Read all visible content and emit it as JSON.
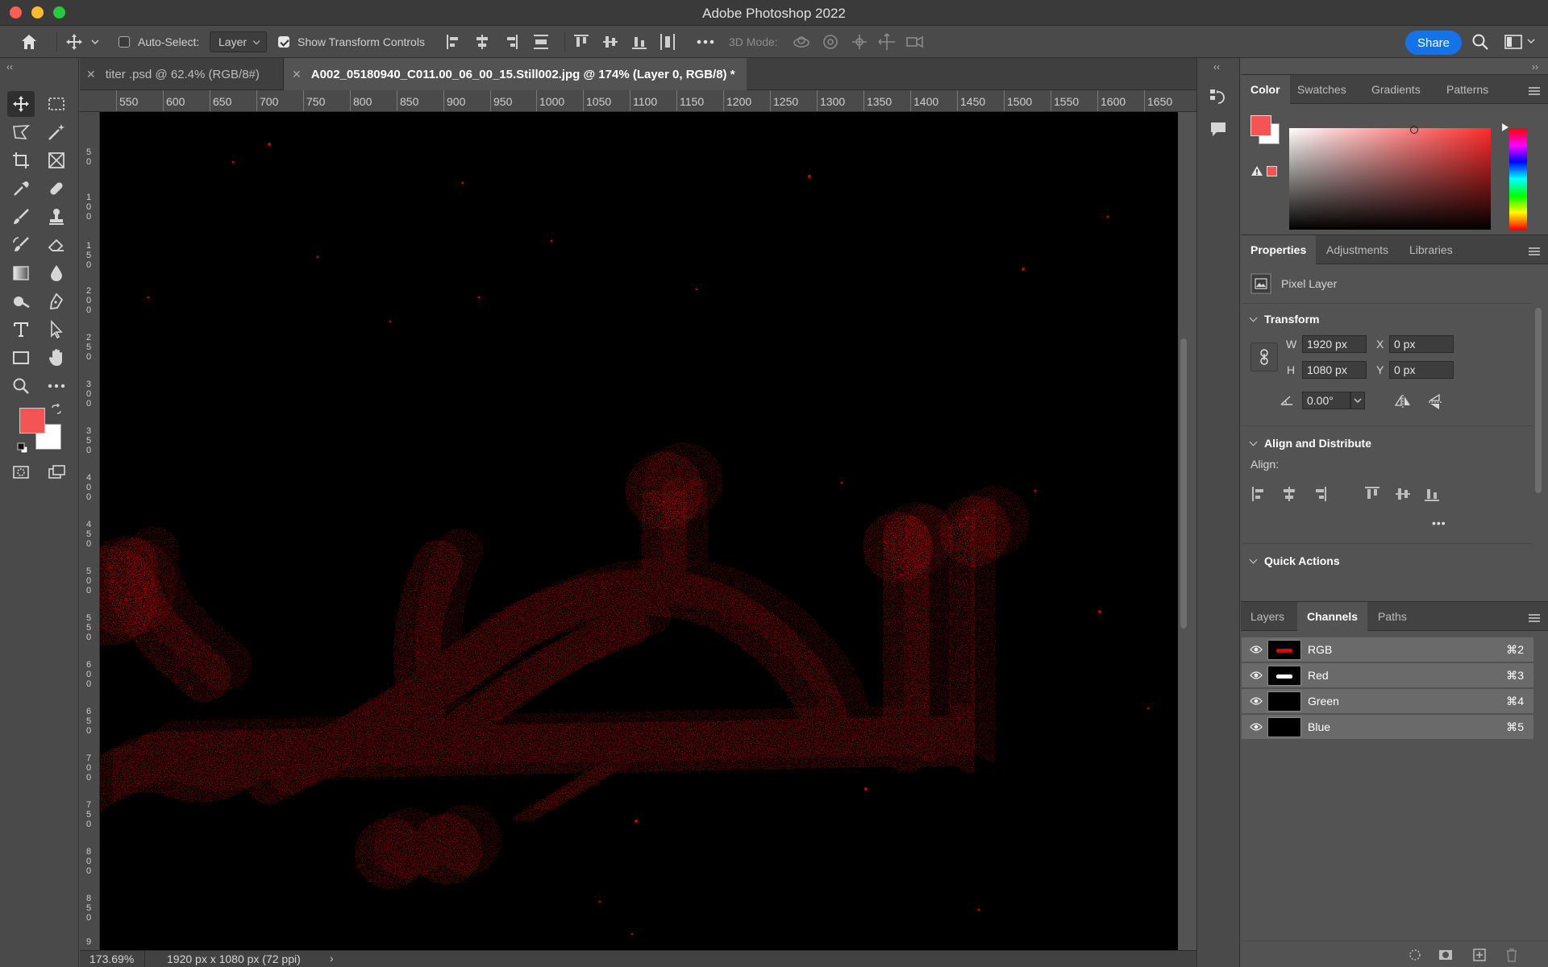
{
  "window": {
    "title": "Adobe Photoshop 2022"
  },
  "options_bar": {
    "auto_select_label": "Auto-Select:",
    "auto_select_checked": false,
    "auto_select_value": "Layer",
    "show_transform_label": "Show Transform Controls",
    "show_transform_checked": true,
    "mode_3d_label": "3D Mode:",
    "share_label": "Share"
  },
  "tabs": [
    {
      "label": "titer .psd @ 62.4% (RGB/8#)",
      "active": false
    },
    {
      "label": "A002_05180940_C011.00_06_00_15.Still002.jpg @ 174% (Layer 0, RGB/8) *",
      "active": true
    }
  ],
  "ruler_h": [
    "550",
    "600",
    "650",
    "700",
    "750",
    "800",
    "850",
    "900",
    "950",
    "1000",
    "1050",
    "1100",
    "1150",
    "1200",
    "1250",
    "1300",
    "1350",
    "1400",
    "1450",
    "1500",
    "1550",
    "1600",
    "1650"
  ],
  "ruler_v": [
    "50",
    "100",
    "150",
    "200",
    "250",
    "300",
    "350",
    "400",
    "450",
    "500",
    "550",
    "600",
    "650",
    "700",
    "750",
    "800",
    "850",
    "9"
  ],
  "status": {
    "zoom": "173.69%",
    "doc_info": "1920 px x 1080 px (72 ppi)",
    "arrow": "›"
  },
  "color_panel": {
    "tabs": [
      "Color",
      "Swatches",
      "Gradients",
      "Patterns"
    ],
    "foreground": "#f45454",
    "background": "#ffffff"
  },
  "properties_panel": {
    "tabs": [
      "Properties",
      "Adjustments",
      "Libraries"
    ],
    "layer_type": "Pixel Layer",
    "transform_title": "Transform",
    "w_label": "W",
    "w_value": "1920 px",
    "h_label": "H",
    "h_value": "1080 px",
    "x_label": "X",
    "x_value": "0 px",
    "y_label": "Y",
    "y_value": "0 px",
    "angle_value": "0.00°",
    "align_title": "Align and Distribute",
    "align_label": "Align:",
    "more_label": "•••",
    "quick_actions_title": "Quick Actions"
  },
  "layers_panel": {
    "tabs": [
      "Layers",
      "Channels",
      "Paths"
    ],
    "channels": [
      {
        "name": "RGB",
        "shortcut": "⌘2"
      },
      {
        "name": "Red",
        "shortcut": "⌘3"
      },
      {
        "name": "Green",
        "shortcut": "⌘4"
      },
      {
        "name": "Blue",
        "shortcut": "⌘5"
      }
    ]
  },
  "colors": {
    "accent": "#1473e6",
    "artwork_red": "#e30000",
    "artwork_shadow": "#9a0d0d"
  }
}
